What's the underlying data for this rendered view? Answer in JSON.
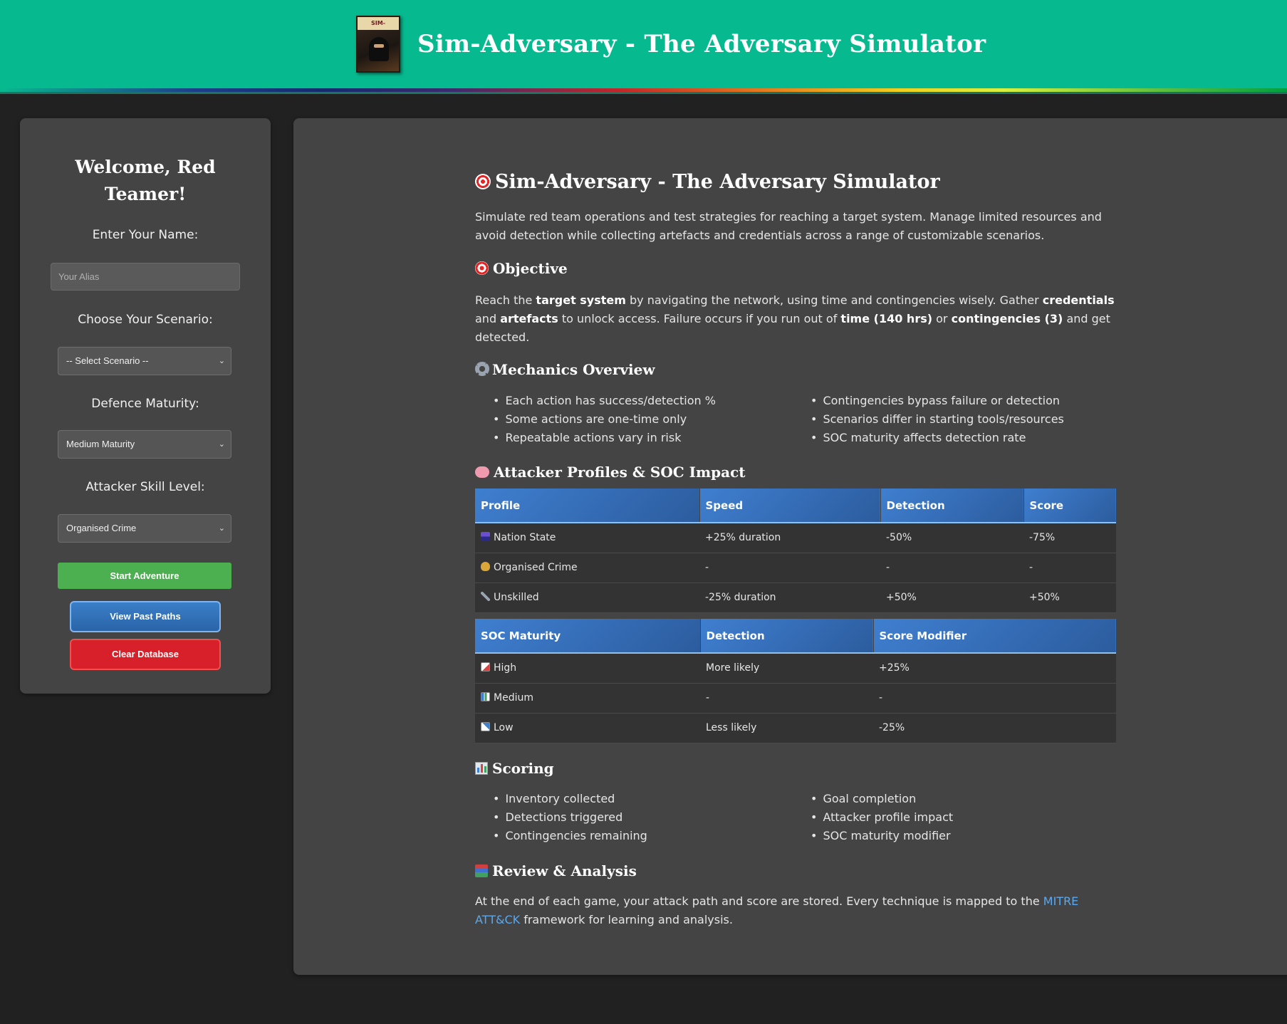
{
  "header": {
    "title": "Sim-Adversary - The Adversary Simulator",
    "logo_text": "SIM-ADVERSARY"
  },
  "sidebar": {
    "welcome": "Welcome, Red Teamer!",
    "name_label": "Enter Your Name:",
    "name_placeholder": "Your Alias",
    "scenario_label": "Choose Your Scenario:",
    "scenario_value": "-- Select Scenario --",
    "maturity_label": "Defence Maturity:",
    "maturity_value": "Medium Maturity",
    "skill_label": "Attacker Skill Level:",
    "skill_value": "Organised Crime",
    "start_button": "Start Adventure",
    "paths_button": "View Past Paths",
    "clear_button": "Clear Database"
  },
  "main": {
    "title": "Sim-Adversary - The Adversary Simulator",
    "intro": "Simulate red team operations and test strategies for reaching a target system. Manage limited resources and avoid detection while collecting artefacts and credentials across a range of customizable scenarios.",
    "objective": {
      "heading": "Objective",
      "t1": "Reach the ",
      "b1": "target system",
      "t2": " by navigating the network, using time and contingencies wisely. Gather ",
      "b2": "credentials",
      "t3": " and ",
      "b3": "artefacts",
      "t4": " to unlock access. Failure occurs if you run out of ",
      "b4": "time (140 hrs)",
      "t5": " or ",
      "b5": "contingencies (3)",
      "t6": " and get detected."
    },
    "mechanics": {
      "heading": "Mechanics Overview",
      "left": [
        "Each action has success/detection %",
        "Some actions are one-time only",
        "Repeatable actions vary in risk"
      ],
      "right": [
        "Contingencies bypass failure or detection",
        "Scenarios differ in starting tools/resources",
        "SOC maturity affects detection rate"
      ]
    },
    "profiles": {
      "heading": "Attacker Profiles & SOC Impact",
      "headers": [
        "Profile",
        "Speed",
        "Detection",
        "Score"
      ],
      "rows": [
        [
          "Nation State",
          "+25% duration",
          "-50%",
          "-75%"
        ],
        [
          "Organised Crime",
          "-",
          "-",
          "-"
        ],
        [
          "Unskilled",
          "-25% duration",
          "+50%",
          "+50%"
        ]
      ]
    },
    "soc": {
      "headers": [
        "SOC Maturity",
        "Detection",
        "Score Modifier"
      ],
      "rows": [
        [
          "High",
          "More likely",
          "+25%"
        ],
        [
          "Medium",
          "-",
          "-"
        ],
        [
          "Low",
          "Less likely",
          "-25%"
        ]
      ]
    },
    "scoring": {
      "heading": "Scoring",
      "left": [
        "Inventory collected",
        "Detections triggered",
        "Contingencies remaining"
      ],
      "right": [
        "Goal completion",
        "Attacker profile impact",
        "SOC maturity modifier"
      ]
    },
    "review": {
      "heading": "Review & Analysis",
      "t1": "At the end of each game, your attack path and score are stored. Every technique is mapped to the ",
      "link": "MITRE ATT&CK",
      "t2": " framework for learning and analysis."
    }
  },
  "colors": {
    "header_bg": "#07b98f",
    "page_bg": "#212121",
    "panel_bg": "#444444",
    "start_button": "#4caf50",
    "paths_button": "#2a64a8",
    "clear_button": "#d8202a",
    "table_header": "#3f7fd0",
    "link": "#5aa8f0"
  },
  "icons": {
    "title": "target-icon",
    "objective": "target-icon",
    "mechanics": "gear-icon",
    "profiles": "brain-icon",
    "scoring": "bar-chart-icon",
    "review": "books-icon"
  }
}
